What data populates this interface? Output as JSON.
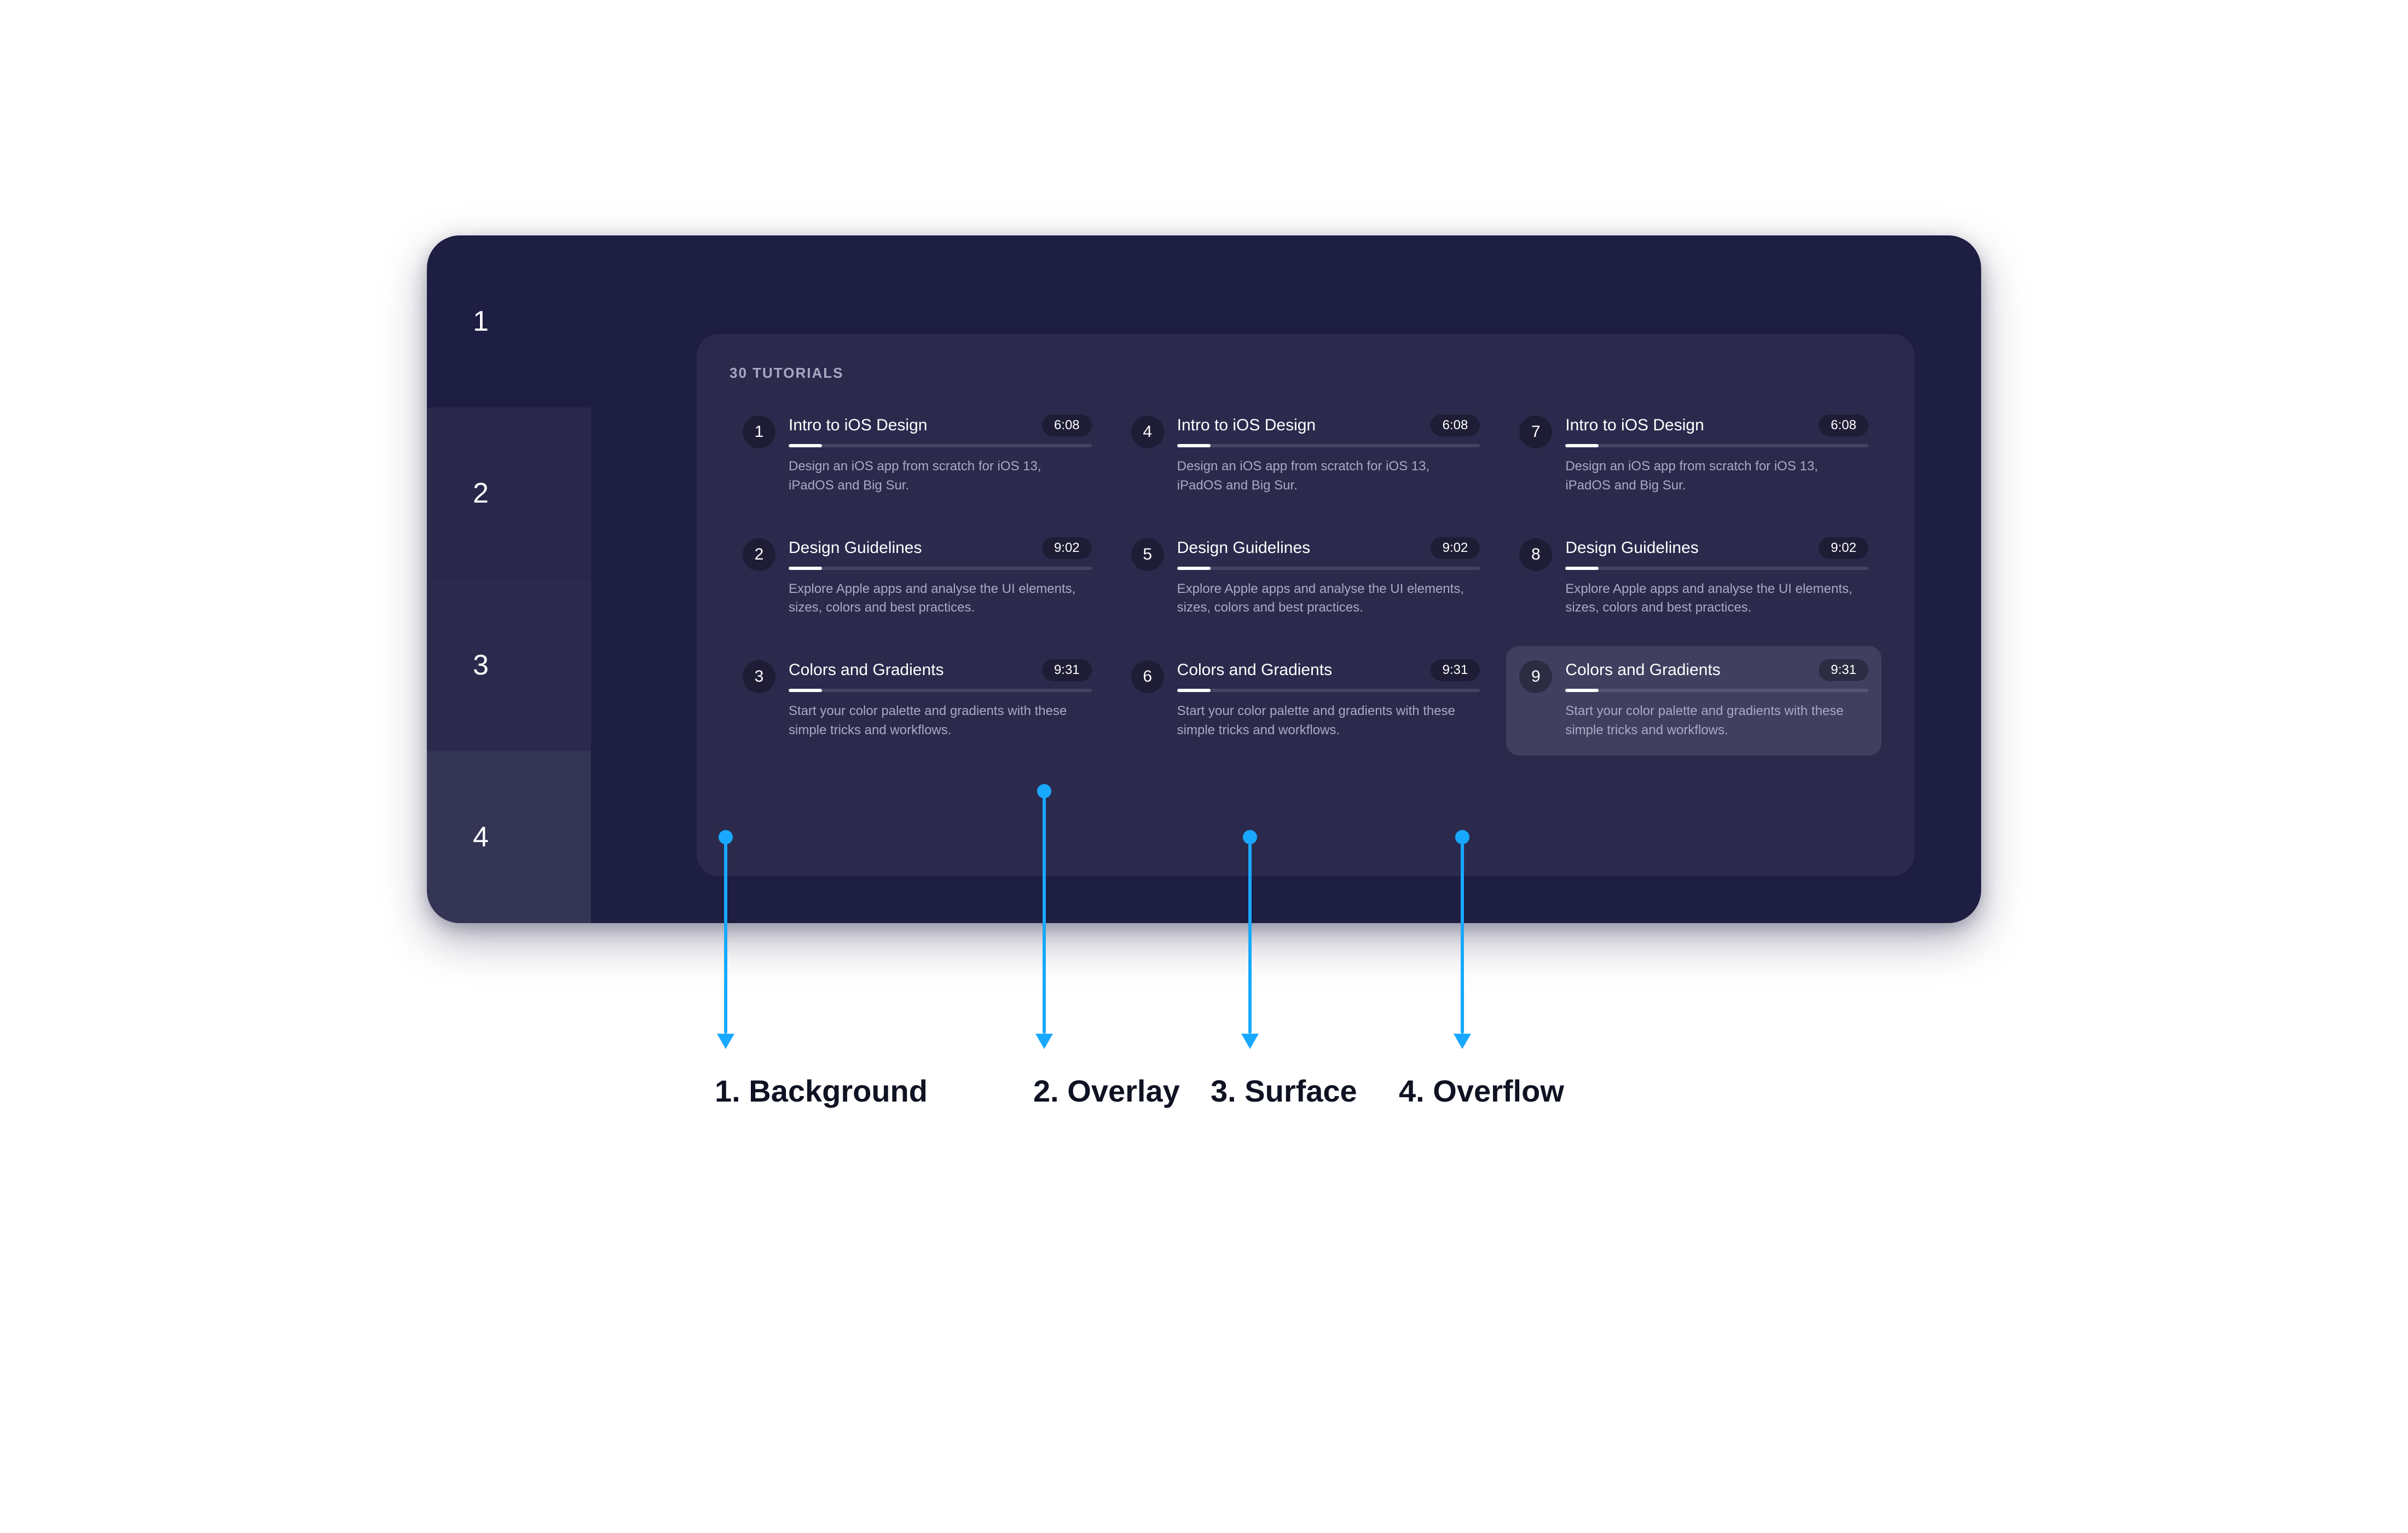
{
  "swatches": [
    {
      "num": "1"
    },
    {
      "num": "2"
    },
    {
      "num": "3"
    },
    {
      "num": "4"
    }
  ],
  "panel": {
    "header": "30 TUTORIALS",
    "items": [
      {
        "n": "1",
        "title": "Intro to iOS Design",
        "duration": "6:08",
        "desc": "Design an iOS app from scratch for iOS 13, iPadOS and Big Sur."
      },
      {
        "n": "4",
        "title": "Intro to iOS Design",
        "duration": "6:08",
        "desc": "Design an iOS app from scratch for iOS 13, iPadOS and Big Sur."
      },
      {
        "n": "7",
        "title": "Intro to iOS Design",
        "duration": "6:08",
        "desc": "Design an iOS app from scratch for iOS 13, iPadOS and Big Sur."
      },
      {
        "n": "2",
        "title": "Design Guidelines",
        "duration": "9:02",
        "desc": "Explore Apple apps and analyse the UI elements, sizes, colors and best practices."
      },
      {
        "n": "5",
        "title": "Design Guidelines",
        "duration": "9:02",
        "desc": "Explore Apple apps and analyse the UI elements, sizes, colors and best practices."
      },
      {
        "n": "8",
        "title": "Design Guidelines",
        "duration": "9:02",
        "desc": "Explore Apple apps and analyse the UI elements, sizes, colors and best practices."
      },
      {
        "n": "3",
        "title": "Colors and Gradients",
        "duration": "9:31",
        "desc": "Start your color palette and gradients with these simple tricks and workflows."
      },
      {
        "n": "6",
        "title": "Colors and Gradients",
        "duration": "9:31",
        "desc": "Start your color palette and gradients with these simple tricks and workflows."
      },
      {
        "n": "9",
        "title": "Colors and Gradients",
        "duration": "9:31",
        "desc": "Start your color palette and gradients with these simple tricks and workflows.",
        "highlight": true
      }
    ]
  },
  "legend": {
    "background": "1. Background",
    "overlay": "2. Overlay",
    "surface": "3. Surface",
    "overflow": "4. Overflow"
  }
}
